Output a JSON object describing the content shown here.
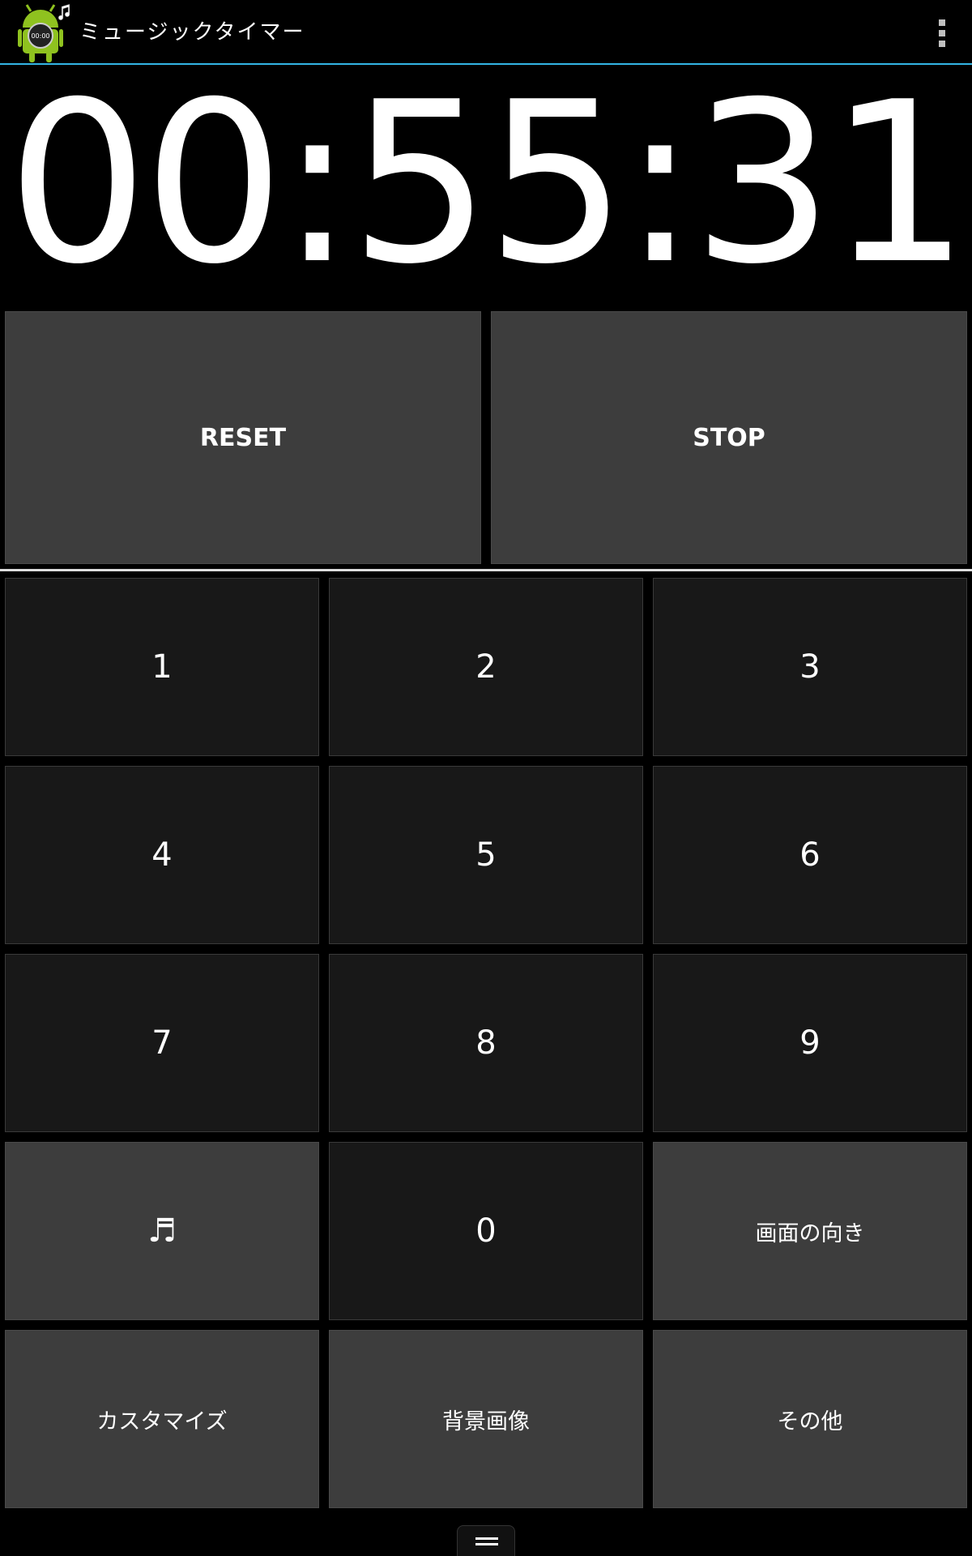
{
  "action_bar": {
    "title": "ミュージックタイマー",
    "icon_label": "00:00",
    "menu_icon": "overflow-menu-icon"
  },
  "timer": {
    "display": "00:55:31"
  },
  "controls": {
    "reset_label": "RESET",
    "stop_label": "STOP"
  },
  "keypad": {
    "keys": [
      "1",
      "2",
      "3",
      "4",
      "5",
      "6",
      "7",
      "8",
      "9",
      "0"
    ],
    "music_symbol": "♬",
    "orientation_label": "画面の向き",
    "customize_label": "カスタマイズ",
    "background_label": "背景画像",
    "other_label": "その他"
  },
  "colors": {
    "accent": "#33b5e5",
    "button_light": "#3d3d3d",
    "button_dark": "#181818"
  }
}
